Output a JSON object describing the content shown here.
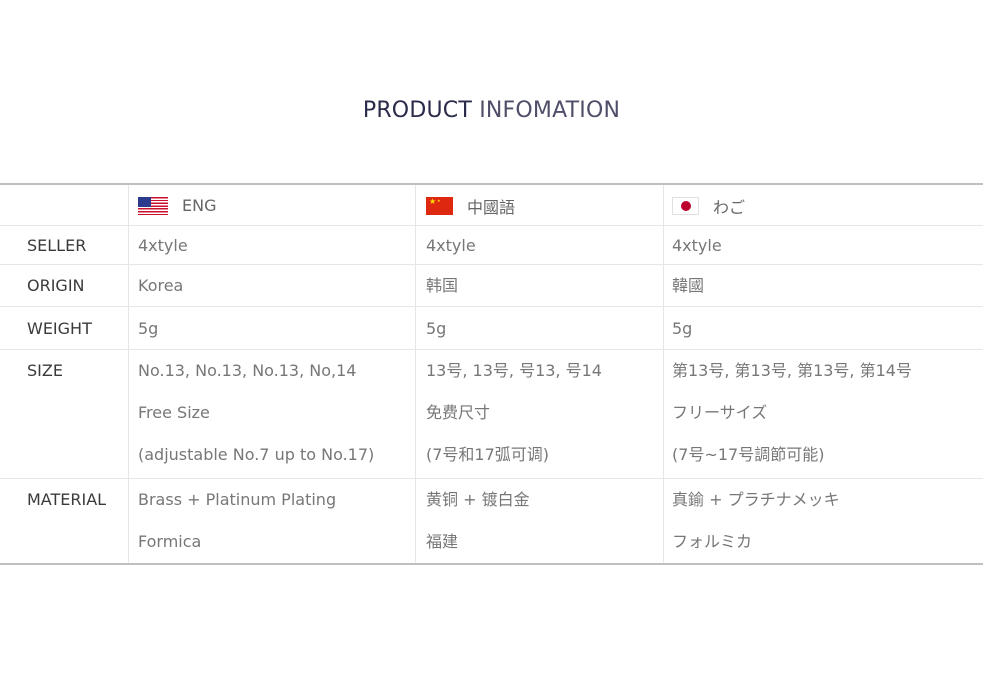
{
  "title": {
    "bold": "PRODUCT",
    "light": "INFOMATION"
  },
  "languages": [
    {
      "label": "ENG",
      "flag": "us-flag-icon"
    },
    {
      "label": "中國語",
      "flag": "china-flag-icon"
    },
    {
      "label": "わご",
      "flag": "japan-flag-icon"
    }
  ],
  "rows": [
    {
      "label": "SELLER",
      "eng": [
        "4xtyle"
      ],
      "cn": [
        "4xtyle"
      ],
      "jp": [
        "4xtyle"
      ]
    },
    {
      "label": "ORIGIN",
      "eng": [
        "Korea"
      ],
      "cn": [
        "韩国"
      ],
      "jp": [
        "韓國"
      ]
    },
    {
      "label": "WEIGHT",
      "eng": [
        "5g"
      ],
      "cn": [
        "5g"
      ],
      "jp": [
        "5g"
      ]
    },
    {
      "label": "SIZE",
      "eng": [
        "No.13, No.13, No.13, No,14",
        "Free Size",
        "(adjustable No.7 up to No.17)"
      ],
      "cn": [
        "13号, 13号, 号13, 号14",
        "免费尺寸",
        "(7号和17弧可调)"
      ],
      "jp": [
        "第13号, 第13号, 第13号, 第14号",
        "フリーサイズ",
        "(7号~17号調節可能)"
      ]
    },
    {
      "label": "MATERIAL",
      "eng": [
        "Brass + Platinum Plating",
        "Formica"
      ],
      "cn": [
        "黄铜 + 镀白金",
        "福建"
      ],
      "jp": [
        "真鍮 + プラチナメッキ",
        "フォルミカ"
      ]
    }
  ],
  "colors": {
    "title_dark": "#2a2a4a",
    "text": "#777777",
    "label": "#3a3a3a",
    "border": "#bfbfbf"
  }
}
